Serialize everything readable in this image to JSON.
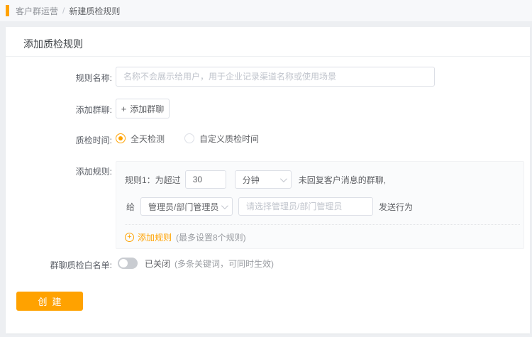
{
  "colors": {
    "accent": "#ffa200",
    "page_bg": "#edeff2",
    "topbar_bg": "#f7f8fa",
    "border": "#dcdfe6",
    "toggle_off": "#c9ccd1"
  },
  "breadcrumb": {
    "section": "客户群运营",
    "separator": "/",
    "current": "新建质检规则"
  },
  "page_title": "添加质检规则",
  "form": {
    "rule_name": {
      "label": "规则名称:",
      "value": "",
      "placeholder": "名称不会展示给用户，用于企业记录渠道名称或使用场景"
    },
    "add_group": {
      "label": "添加群聊:",
      "plus": "+",
      "button_label": "添加群聊"
    },
    "inspect_time": {
      "label": "质检时间:",
      "options": [
        {
          "label": "全天检测",
          "selected": true
        },
        {
          "label": "自定义质检时间",
          "selected": false
        }
      ]
    },
    "rules": {
      "label": "添加规则:",
      "rule1": {
        "prefix": "规则1：为超过",
        "duration_value": "30",
        "unit": "分钟",
        "condition_suffix": "未回复客户消息的群聊,",
        "to": "给",
        "recipient": "管理员/部门管理员",
        "recipient_placeholder": "请选择管理员/部门管理员",
        "action": "发送行为"
      },
      "add_rule": {
        "plus": "+",
        "label": "添加规则",
        "hint": "(最多设置8个规则)"
      }
    },
    "whitelist": {
      "label": "群聊质检白名单:",
      "state": "已关闭",
      "hint": "(多条关键词，可同时生效)"
    }
  },
  "footer": {
    "create": "创建"
  }
}
